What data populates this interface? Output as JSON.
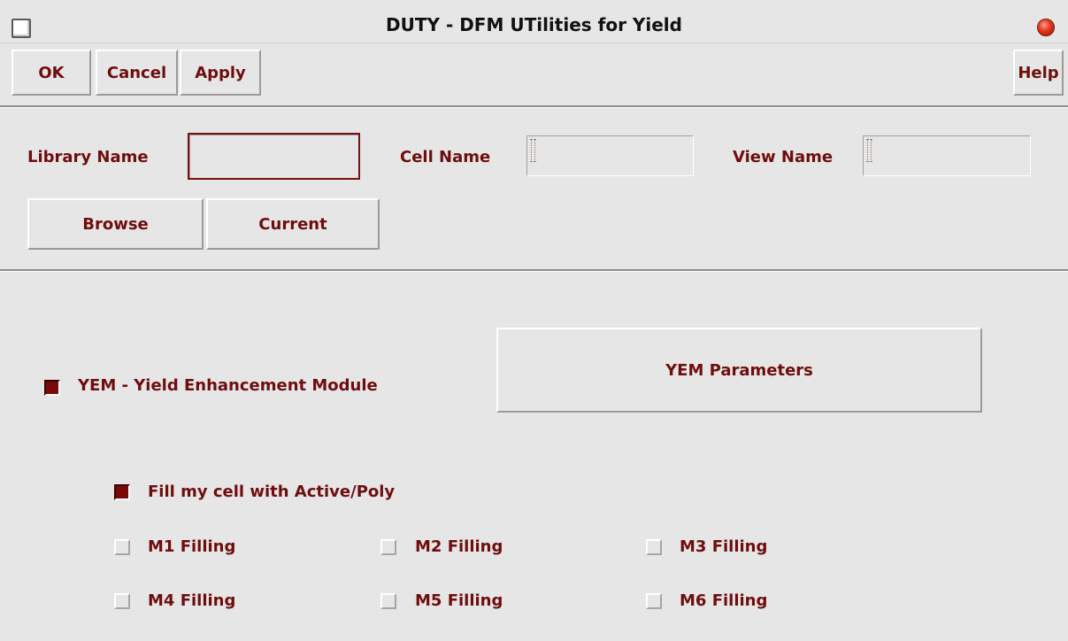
{
  "window": {
    "title": "DUTY - DFM UTilities for Yield"
  },
  "toolbar": {
    "ok_label": "OK",
    "cancel_label": "Cancel",
    "apply_label": "Apply",
    "help_label": "Help"
  },
  "cell_selection": {
    "library_label": "Library Name",
    "library_value": "",
    "cell_label": "Cell Name",
    "cell_value": "",
    "view_label": "View Name",
    "view_value": "",
    "browse_label": "Browse",
    "current_label": "Current"
  },
  "yem": {
    "enabled": true,
    "label": "YEM - Yield Enhancement Module",
    "parameters_button": "YEM Parameters"
  },
  "filling": {
    "active_poly": {
      "label": "Fill my cell with Active/Poly",
      "checked": true
    },
    "metals": [
      {
        "label": "M1 Filling",
        "checked": false
      },
      {
        "label": "M2 Filling",
        "checked": false
      },
      {
        "label": "M3 Filling",
        "checked": false
      },
      {
        "label": "M4 Filling",
        "checked": false
      },
      {
        "label": "M5 Filling",
        "checked": false
      },
      {
        "label": "M6 Filling",
        "checked": false
      }
    ]
  },
  "colors": {
    "accent": "#6e0d0d",
    "background": "#e6e6e6",
    "checked_fill": "#7a0a0a"
  }
}
